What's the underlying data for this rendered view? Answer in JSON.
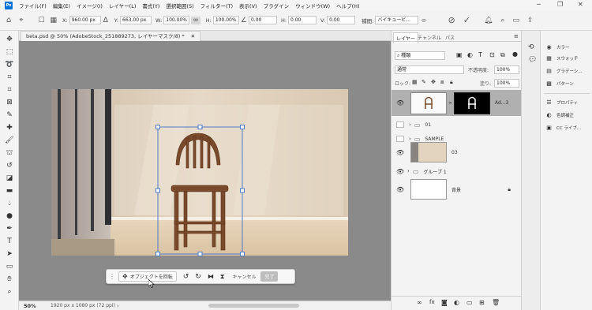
{
  "menubar": {
    "items": [
      "ファイル(F)",
      "編集(E)",
      "イメージ(I)",
      "レイヤー(L)",
      "書式(Y)",
      "選択範囲(S)",
      "フィルター(T)",
      "表示(V)",
      "プラグイン",
      "ウィンドウ(W)",
      "ヘルプ(H)"
    ],
    "logo": "Ps"
  },
  "options": {
    "x_label": "X:",
    "x_value": "960.00 px",
    "y_label": "Y:",
    "y_value": "663.00 px",
    "w_label": "W:",
    "w_value": "100.00%",
    "h_label": "H:",
    "h_value": "100.00%",
    "angle_value": "0.00",
    "hskew_label": "H:",
    "hskew_value": "0.00",
    "vskew_label": "V:",
    "vskew_value": "0.00",
    "interp_label": "補間:",
    "interp_value": "バイキュービ..."
  },
  "document": {
    "tab_title": "beta.psd @ 50% (AdobeStock_251889273, レイヤーマスク/8) *",
    "zoom": "50%",
    "doc_info": "1920 px x 1080 px (72 ppi)"
  },
  "taskbar": {
    "rotate_label": "オブジェクトを回転",
    "cancel_label": "キャンセル",
    "done_label": "完了"
  },
  "layers_panel": {
    "tabs": [
      "レイヤー",
      "チャンネル",
      "パス"
    ],
    "filter_kind": "種類",
    "blend_mode": "通常",
    "opacity_label": "不透明度:",
    "opacity_value": "100%",
    "lock_label": "ロック:",
    "fill_label": "塗り:",
    "fill_value": "100%",
    "layers": [
      {
        "name": "Ad...3",
        "visible": true,
        "selected": true
      },
      {
        "name": "01",
        "visible": false,
        "group": true
      },
      {
        "name": "SAMPLE",
        "visible": false,
        "group": true
      },
      {
        "name": "03",
        "visible": true
      },
      {
        "name": "グループ 1",
        "visible": true,
        "group": true
      },
      {
        "name": "背景",
        "visible": true,
        "locked": true
      }
    ]
  },
  "right_panel": {
    "items": [
      "カラー",
      "スウォッチ",
      "グラデーシ...",
      "パターン",
      "プロパティ",
      "色調補正",
      "CC ライブ..."
    ]
  },
  "colors": {
    "accent": "#0a74d8",
    "canvas_bg": "#8a8a8a",
    "selection": "#4f7ac7"
  }
}
